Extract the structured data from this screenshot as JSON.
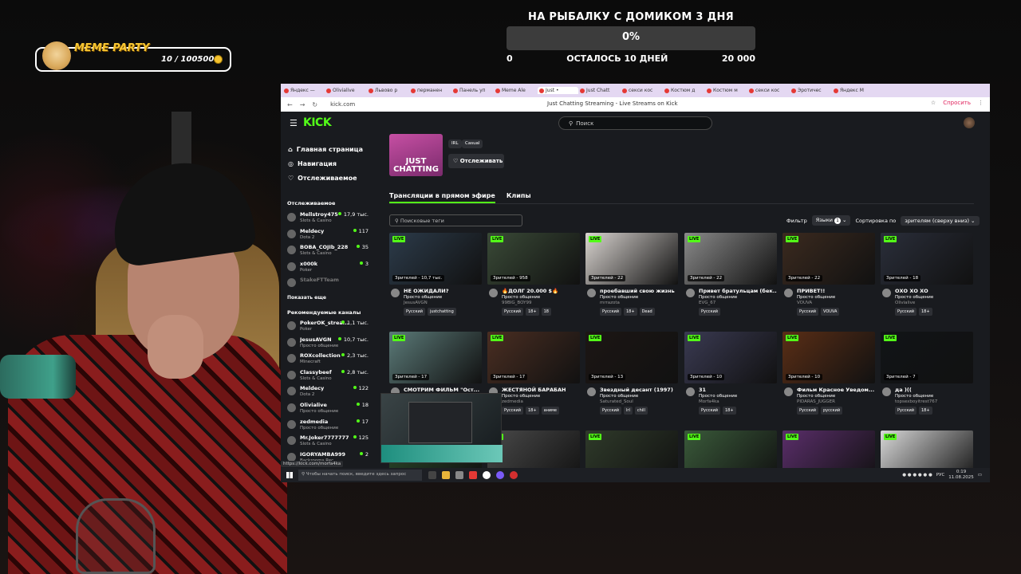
{
  "goal": {
    "title": "НА РЫБАЛКУ С ДОМИКОМ 3 ДНЯ",
    "percent_text": "0%",
    "progress": 0,
    "min": "0",
    "remaining": "ОСТАЛОСЬ 10 ДНЕЙ",
    "max": "20 000"
  },
  "meme_widget": {
    "title": "MEME PARTY",
    "count": "10 / 100500"
  },
  "browser": {
    "tabs": [
      {
        "label": "Яндекс —",
        "active": false
      },
      {
        "label": "Olivialive",
        "active": false
      },
      {
        "label": "Львово р",
        "active": false
      },
      {
        "label": "перманен",
        "active": false
      },
      {
        "label": "Панель уп",
        "active": false
      },
      {
        "label": "Meme Ale",
        "active": false
      },
      {
        "label": "Just •",
        "active": true
      },
      {
        "label": "Just Chatt",
        "active": false
      },
      {
        "label": "секси кос",
        "active": false
      },
      {
        "label": "Костюм д",
        "active": false
      },
      {
        "label": "Костюм м",
        "active": false
      },
      {
        "label": "секси кос",
        "active": false
      },
      {
        "label": "Эротичес",
        "active": false
      },
      {
        "label": "Яндекс М",
        "active": false
      }
    ],
    "url": "kick.com",
    "page_title": "Just Chatting Streaming - Live Streams on Kick",
    "ask_label": "Спросить"
  },
  "kick": {
    "logo": "KICK",
    "search_placeholder": "Поиск",
    "nav": [
      {
        "label": "Главная страница",
        "icon": "home-icon"
      },
      {
        "label": "Навигация",
        "icon": "compass-icon"
      },
      {
        "label": "Отслеживаемое",
        "icon": "heart-icon"
      }
    ],
    "followed_heading": "Отслеживаемое",
    "followed": [
      {
        "name": "Mellstroy475",
        "category": "Slots & Casino",
        "viewers": "17,9 тыс."
      },
      {
        "name": "Meldecy",
        "category": "Dota 2",
        "viewers": "117"
      },
      {
        "name": "BOBA_COJIb_228",
        "category": "Slots & Casino",
        "viewers": "35"
      },
      {
        "name": "x000k",
        "category": "Poker",
        "viewers": "3"
      },
      {
        "name": "StakeFTTeam",
        "category": "",
        "viewers": "",
        "offline": true
      }
    ],
    "show_more": "Показать еще",
    "recommended_heading": "Рекомендуемые каналы",
    "recommended": [
      {
        "name": "PokerOK_strea...",
        "category": "Poker",
        "viewers": "1,1 тыс."
      },
      {
        "name": "JesusAVGN",
        "category": "Просто общение",
        "viewers": "10,7 тыс."
      },
      {
        "name": "ROXcollection",
        "category": "Minecraft",
        "viewers": "2,3 тыс."
      },
      {
        "name": "Classybeef",
        "category": "Slots & Casino",
        "viewers": "2,8 тыс."
      },
      {
        "name": "Meldecy",
        "category": "Dota 2",
        "viewers": "122"
      },
      {
        "name": "Olivialive",
        "category": "Просто общение",
        "viewers": "18"
      },
      {
        "name": "zedmedia",
        "category": "Просто общение",
        "viewers": "17"
      },
      {
        "name": "Mr.Joker7777777",
        "category": "Slots & Casino",
        "viewers": "125"
      },
      {
        "name": "IGORYAMBA999",
        "category": "Backrooms Rec...",
        "viewers": "2"
      }
    ],
    "status_url": "https://kick.com/morfa4ka",
    "category": {
      "thumb_text": "JUST CHATTING",
      "tags": [
        "IRL",
        "Casual"
      ],
      "follow_label": "Отслеживать"
    },
    "tabs": [
      "Трансляции в прямом эфире",
      "Клипы"
    ],
    "tag_search_placeholder": "Поисковые теги",
    "filter_label": "Фильтр",
    "languages_label": "Языки",
    "languages_count": "1",
    "sort_label": "Сортировка по",
    "sort_value": "зрителям (сверху вниз)",
    "live_label": "LIVE",
    "streams": [
      {
        "viewers": "Зрителей - 10,7 тыс.",
        "title": "НЕ ОЖИДАЛИ?",
        "category": "Просто общение",
        "user": "JesusAVGN",
        "tags": [
          "Русский",
          "justchatting"
        ],
        "color": "#2c3b4a"
      },
      {
        "viewers": "Зрителей - 958",
        "title": "🔥ДОЛГ 20.000 $🔥",
        "category": "Просто общение",
        "user": "99BIG_BOY99",
        "tags": [
          "Русский",
          "18+",
          "18"
        ],
        "color": "#3a4a37"
      },
      {
        "viewers": "Зрителей - 22",
        "title": "проебавший свою жизнь",
        "category": "Просто общение",
        "user": "mrrazota",
        "tags": [
          "Русский",
          "18+",
          "Dead"
        ],
        "color": "#d9d4d0"
      },
      {
        "viewers": "Зрителей - 22",
        "title": "Привет братульцам (бек...",
        "category": "Просто общение",
        "user": "EVG_67",
        "tags": [
          "Русский"
        ],
        "color": "#8a8a8a"
      },
      {
        "viewers": "Зрителей - 22",
        "title": "ПРИВЕТ!!",
        "category": "Просто общение",
        "user": "VOUVA",
        "tags": [
          "Русский",
          "VOUVA"
        ],
        "color": "#3b2a1f"
      },
      {
        "viewers": "Зрителей - 18",
        "title": "ОХО ХО ХО",
        "category": "Просто общение",
        "user": "Olivialive",
        "tags": [
          "Русский",
          "18+"
        ],
        "color": "#2a2e3a"
      },
      {
        "viewers": "Зрителей - 17",
        "title": "СМОТРИМ ФИЛЬМ \"Ост...",
        "category": "Просто общение",
        "user": "zedmedia",
        "tags": [
          "Русский"
        ],
        "color": "#5b7a78"
      },
      {
        "viewers": "Зрителей - 17",
        "title": "ЖЕСТЯНОЙ БАРАБАН",
        "category": "Просто общение",
        "user": "zedmedia",
        "tags": [
          "Русский",
          "18+",
          "аниме"
        ],
        "color": "#4a2e22"
      },
      {
        "viewers": "Зрителей - 13",
        "title": "Звездный десант (1997)",
        "category": "Просто общение",
        "user": "Saturated_Soul",
        "tags": [
          "Русский",
          "lrl",
          "chill"
        ],
        "color": "#1c1614"
      },
      {
        "viewers": "Зрителей - 10",
        "title": "31",
        "category": "Просто общение",
        "user": "Morfa4ka",
        "tags": [
          "Русский",
          "18+"
        ],
        "color": "#3a3a52"
      },
      {
        "viewers": "Зрителей - 10",
        "title": "Фильм Красное Уведом...",
        "category": "Просто общение",
        "user": "PIDARAS_JUGGER",
        "tags": [
          "Русский",
          "русский"
        ],
        "color": "#5a2e16"
      },
      {
        "viewers": "Зрителей - 7",
        "title": "да )((",
        "category": "Просто общение",
        "user": "topsexboyitrest767",
        "tags": [
          "Русский",
          "18+"
        ],
        "color": "#111417"
      }
    ],
    "row3_colors": [
      "#2a4a2a",
      "#4a4a4a",
      "#2f3a2a",
      "#3a5a3a",
      "#5a2e6a",
      "#d8d8d8"
    ]
  },
  "taskbar": {
    "search_placeholder": "Чтобы начать поиск, введите здесь запрос",
    "lang": "РУС",
    "time": "0:19",
    "date": "11.08.2025"
  },
  "colors": {
    "kick_green": "#53fc18",
    "kick_bg": "#191b1f",
    "goal_fill": "#6a9cff",
    "meme_title": "#f7c531"
  }
}
